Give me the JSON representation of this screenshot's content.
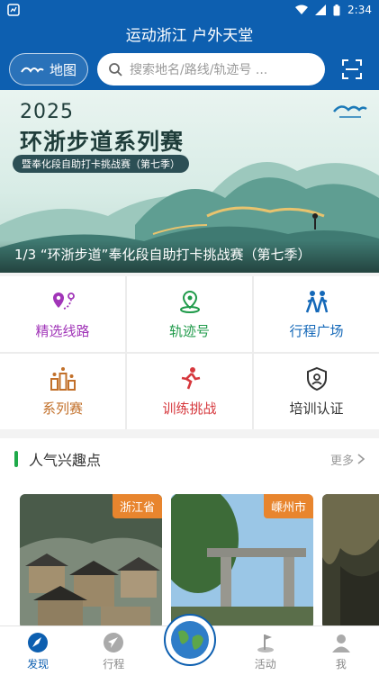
{
  "status": {
    "time": "2:34"
  },
  "header": {
    "title": "运动浙江 户外天堂",
    "map_label": "地图",
    "search_placeholder": "搜索地名/路线/轨迹号 ..."
  },
  "banner": {
    "year": "2025",
    "title": "环浙步道系列赛",
    "subtitle": "暨奉化段自助打卡挑战赛（第七季）",
    "caption": "1/3 “环浙步道”奉化段自助打卡挑战赛（第七季）",
    "page_index": 1,
    "page_count": 3
  },
  "menu": {
    "items": [
      {
        "label": "精选线路",
        "icon": "route-pin-icon",
        "color": "#a135b8"
      },
      {
        "label": "轨迹号",
        "icon": "track-pin-icon",
        "color": "#1f9a4a"
      },
      {
        "label": "行程广场",
        "icon": "hikers-icon",
        "color": "#1468b8"
      },
      {
        "label": "系列赛",
        "icon": "podium-icon",
        "color": "#c2702a"
      },
      {
        "label": "训练挑战",
        "icon": "runner-icon",
        "color": "#d6383d"
      },
      {
        "label": "培训认证",
        "icon": "badge-icon",
        "color": "#333333"
      }
    ]
  },
  "section": {
    "title": "人气兴趣点",
    "more": "更多"
  },
  "cards": [
    {
      "tag": "浙江省"
    },
    {
      "tag": "嵊州市"
    },
    {
      "tag": ""
    }
  ],
  "nav": {
    "items": [
      {
        "label": "发现",
        "active": true
      },
      {
        "label": "行程",
        "active": false
      },
      {
        "label": "活动",
        "active": false
      },
      {
        "label": "我",
        "active": false
      }
    ]
  },
  "colors": {
    "primary": "#0d5fb0",
    "accent_green": "#1faa4a",
    "tag_orange": "#e8852e"
  }
}
